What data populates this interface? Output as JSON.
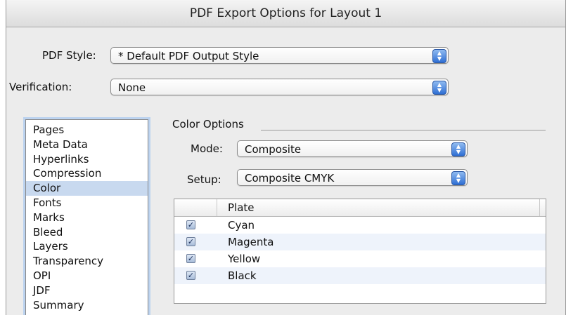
{
  "window": {
    "title": "PDF Export Options for Layout 1"
  },
  "pdf_style": {
    "label": "PDF Style:",
    "value": "* Default PDF Output Style"
  },
  "verification": {
    "label": "Verification:",
    "value": "None"
  },
  "sidebar": {
    "items": [
      "Pages",
      "Meta Data",
      "Hyperlinks",
      "Compression",
      "Color",
      "Fonts",
      "Marks",
      "Bleed",
      "Layers",
      "Transparency",
      "OPI",
      "JDF",
      "Summary"
    ],
    "selected": "Color"
  },
  "color_options": {
    "title": "Color Options",
    "mode": {
      "label": "Mode:",
      "value": "Composite"
    },
    "setup": {
      "label": "Setup:",
      "value": "Composite CMYK"
    },
    "table": {
      "header": "Plate",
      "rows": [
        {
          "name": "Cyan",
          "checked": true
        },
        {
          "name": "Magenta",
          "checked": true
        },
        {
          "name": "Yellow",
          "checked": true
        },
        {
          "name": "Black",
          "checked": true
        }
      ]
    }
  },
  "colors": {
    "selection": "#c8d9ef",
    "accent": "#2f6fd4",
    "focus_ring": "#bcd3ef"
  },
  "icons": {
    "popup": "up-down-arrows-icon",
    "check": "checkmark-icon"
  }
}
